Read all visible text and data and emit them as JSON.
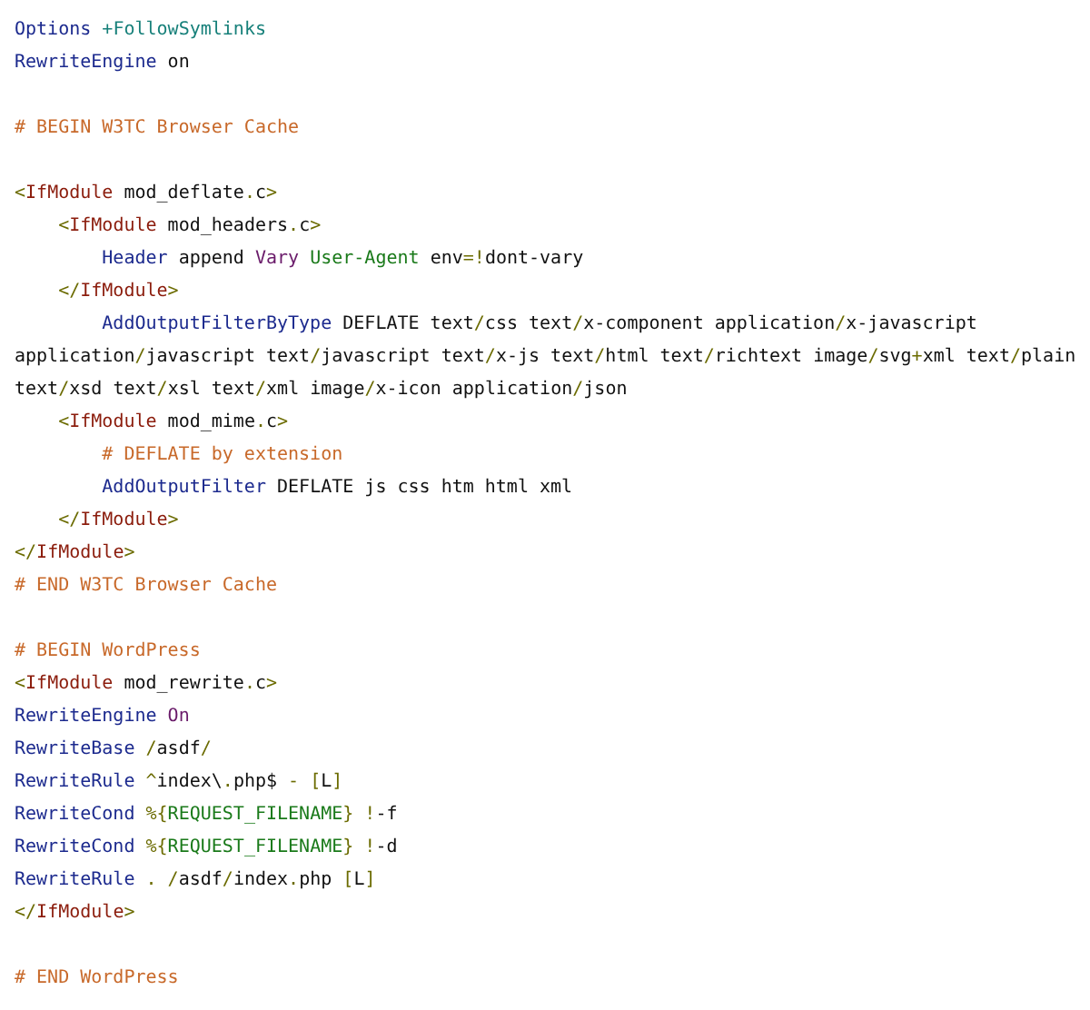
{
  "code_lines": [
    {
      "kind": "code",
      "tokens": [
        {
          "kind": "directive",
          "text": "Options "
        },
        {
          "kind": "option",
          "text": "+FollowSymlinks"
        }
      ]
    },
    {
      "kind": "code",
      "tokens": [
        {
          "kind": "directive",
          "text": "RewriteEngine"
        },
        {
          "kind": "plain",
          "text": " on"
        }
      ]
    },
    {
      "kind": "blank"
    },
    {
      "kind": "code",
      "tokens": [
        {
          "kind": "comment",
          "text": "# BEGIN W3TC Browser Cache"
        }
      ]
    },
    {
      "kind": "blank"
    },
    {
      "kind": "code",
      "tokens": [
        {
          "kind": "punct",
          "text": "<"
        },
        {
          "kind": "tag",
          "text": "IfModule"
        },
        {
          "kind": "plain",
          "text": " mod_deflate"
        },
        {
          "kind": "punct",
          "text": "."
        },
        {
          "kind": "plain",
          "text": "c"
        },
        {
          "kind": "punct",
          "text": ">"
        }
      ]
    },
    {
      "kind": "code",
      "tokens": [
        {
          "kind": "punct",
          "text": "    <"
        },
        {
          "kind": "tag",
          "text": "IfModule"
        },
        {
          "kind": "plain",
          "text": " mod_headers"
        },
        {
          "kind": "punct",
          "text": "."
        },
        {
          "kind": "plain",
          "text": "c"
        },
        {
          "kind": "punct",
          "text": ">"
        }
      ]
    },
    {
      "kind": "code",
      "tokens": [
        {
          "kind": "directive",
          "text": "        Header"
        },
        {
          "kind": "plain",
          "text": " append "
        },
        {
          "kind": "value",
          "text": "Vary "
        },
        {
          "kind": "string",
          "text": "User-Agent"
        },
        {
          "kind": "plain",
          "text": " env"
        },
        {
          "kind": "punct",
          "text": "=!"
        },
        {
          "kind": "plain",
          "text": "dont-vary"
        }
      ]
    },
    {
      "kind": "code",
      "tokens": [
        {
          "kind": "punct",
          "text": "    </"
        },
        {
          "kind": "tag",
          "text": "IfModule"
        },
        {
          "kind": "punct",
          "text": ">"
        }
      ]
    },
    {
      "kind": "code",
      "tokens": [
        {
          "kind": "directive",
          "text": "        AddOutputFilterByType"
        },
        {
          "kind": "plain",
          "text": " DEFLATE text"
        },
        {
          "kind": "punct",
          "text": "/"
        },
        {
          "kind": "plain",
          "text": "css text"
        },
        {
          "kind": "punct",
          "text": "/"
        },
        {
          "kind": "plain",
          "text": "x-component application"
        },
        {
          "kind": "punct",
          "text": "/"
        },
        {
          "kind": "plain",
          "text": "x-javascript"
        }
      ]
    },
    {
      "kind": "code",
      "tokens": [
        {
          "kind": "plain",
          "text": "application"
        },
        {
          "kind": "punct",
          "text": "/"
        },
        {
          "kind": "plain",
          "text": "javascript text"
        },
        {
          "kind": "punct",
          "text": "/"
        },
        {
          "kind": "plain",
          "text": "javascript text"
        },
        {
          "kind": "punct",
          "text": "/"
        },
        {
          "kind": "plain",
          "text": "x-js text"
        },
        {
          "kind": "punct",
          "text": "/"
        },
        {
          "kind": "plain",
          "text": "html text"
        },
        {
          "kind": "punct",
          "text": "/"
        },
        {
          "kind": "plain",
          "text": "richtext image"
        },
        {
          "kind": "punct",
          "text": "/"
        },
        {
          "kind": "plain",
          "text": "svg"
        },
        {
          "kind": "punct",
          "text": "+"
        },
        {
          "kind": "plain",
          "text": "xml text"
        },
        {
          "kind": "punct",
          "text": "/"
        },
        {
          "kind": "plain",
          "text": "plain"
        }
      ]
    },
    {
      "kind": "code",
      "tokens": [
        {
          "kind": "plain",
          "text": "text"
        },
        {
          "kind": "punct",
          "text": "/"
        },
        {
          "kind": "plain",
          "text": "xsd text"
        },
        {
          "kind": "punct",
          "text": "/"
        },
        {
          "kind": "plain",
          "text": "xsl text"
        },
        {
          "kind": "punct",
          "text": "/"
        },
        {
          "kind": "plain",
          "text": "xml image"
        },
        {
          "kind": "punct",
          "text": "/"
        },
        {
          "kind": "plain",
          "text": "x-icon application"
        },
        {
          "kind": "punct",
          "text": "/"
        },
        {
          "kind": "plain",
          "text": "json"
        }
      ]
    },
    {
      "kind": "code",
      "tokens": [
        {
          "kind": "punct",
          "text": "    <"
        },
        {
          "kind": "tag",
          "text": "IfModule"
        },
        {
          "kind": "plain",
          "text": " mod_mime"
        },
        {
          "kind": "punct",
          "text": "."
        },
        {
          "kind": "plain",
          "text": "c"
        },
        {
          "kind": "punct",
          "text": ">"
        }
      ]
    },
    {
      "kind": "code",
      "tokens": [
        {
          "kind": "comment",
          "text": "        # DEFLATE by extension"
        }
      ]
    },
    {
      "kind": "code",
      "tokens": [
        {
          "kind": "directive",
          "text": "        AddOutputFilter"
        },
        {
          "kind": "plain",
          "text": " DEFLATE js css htm html xml"
        }
      ]
    },
    {
      "kind": "code",
      "tokens": [
        {
          "kind": "punct",
          "text": "    </"
        },
        {
          "kind": "tag",
          "text": "IfModule"
        },
        {
          "kind": "punct",
          "text": ">"
        }
      ]
    },
    {
      "kind": "code",
      "tokens": [
        {
          "kind": "punct",
          "text": "</"
        },
        {
          "kind": "tag",
          "text": "IfModule"
        },
        {
          "kind": "punct",
          "text": ">"
        }
      ]
    },
    {
      "kind": "code",
      "tokens": [
        {
          "kind": "comment",
          "text": "# END W3TC Browser Cache"
        }
      ]
    },
    {
      "kind": "blank"
    },
    {
      "kind": "code",
      "tokens": [
        {
          "kind": "comment",
          "text": "# BEGIN WordPress"
        }
      ]
    },
    {
      "kind": "code",
      "tokens": [
        {
          "kind": "punct",
          "text": "<"
        },
        {
          "kind": "tag",
          "text": "IfModule"
        },
        {
          "kind": "plain",
          "text": " mod_rewrite"
        },
        {
          "kind": "punct",
          "text": "."
        },
        {
          "kind": "plain",
          "text": "c"
        },
        {
          "kind": "punct",
          "text": ">"
        }
      ]
    },
    {
      "kind": "code",
      "tokens": [
        {
          "kind": "directive",
          "text": "RewriteEngine "
        },
        {
          "kind": "value",
          "text": "On"
        }
      ]
    },
    {
      "kind": "code",
      "tokens": [
        {
          "kind": "directive",
          "text": "RewriteBase "
        },
        {
          "kind": "punct",
          "text": "/"
        },
        {
          "kind": "plain",
          "text": "asdf"
        },
        {
          "kind": "punct",
          "text": "/"
        }
      ]
    },
    {
      "kind": "code",
      "tokens": [
        {
          "kind": "directive",
          "text": "RewriteRule "
        },
        {
          "kind": "punct",
          "text": "^"
        },
        {
          "kind": "plain",
          "text": "index\\"
        },
        {
          "kind": "punct",
          "text": "."
        },
        {
          "kind": "plain",
          "text": "php$ "
        },
        {
          "kind": "punct",
          "text": "- ["
        },
        {
          "kind": "plain",
          "text": "L"
        },
        {
          "kind": "punct",
          "text": "]"
        }
      ]
    },
    {
      "kind": "code",
      "tokens": [
        {
          "kind": "directive",
          "text": "RewriteCond "
        },
        {
          "kind": "punct",
          "text": "%{"
        },
        {
          "kind": "string",
          "text": "REQUEST_FILENAME"
        },
        {
          "kind": "punct",
          "text": "} !"
        },
        {
          "kind": "plain",
          "text": "-f"
        }
      ]
    },
    {
      "kind": "code",
      "tokens": [
        {
          "kind": "directive",
          "text": "RewriteCond "
        },
        {
          "kind": "punct",
          "text": "%{"
        },
        {
          "kind": "string",
          "text": "REQUEST_FILENAME"
        },
        {
          "kind": "punct",
          "text": "} !"
        },
        {
          "kind": "plain",
          "text": "-d"
        }
      ]
    },
    {
      "kind": "code",
      "tokens": [
        {
          "kind": "directive",
          "text": "RewriteRule "
        },
        {
          "kind": "punct",
          "text": ". /"
        },
        {
          "kind": "plain",
          "text": "asdf"
        },
        {
          "kind": "punct",
          "text": "/"
        },
        {
          "kind": "plain",
          "text": "index"
        },
        {
          "kind": "punct",
          "text": "."
        },
        {
          "kind": "plain",
          "text": "php "
        },
        {
          "kind": "punct",
          "text": "["
        },
        {
          "kind": "plain",
          "text": "L"
        },
        {
          "kind": "punct",
          "text": "]"
        }
      ]
    },
    {
      "kind": "code",
      "tokens": [
        {
          "kind": "punct",
          "text": "</"
        },
        {
          "kind": "tag",
          "text": "IfModule"
        },
        {
          "kind": "punct",
          "text": ">"
        }
      ]
    },
    {
      "kind": "blank"
    },
    {
      "kind": "code",
      "tokens": [
        {
          "kind": "comment",
          "text": "# END WordPress"
        }
      ]
    }
  ]
}
